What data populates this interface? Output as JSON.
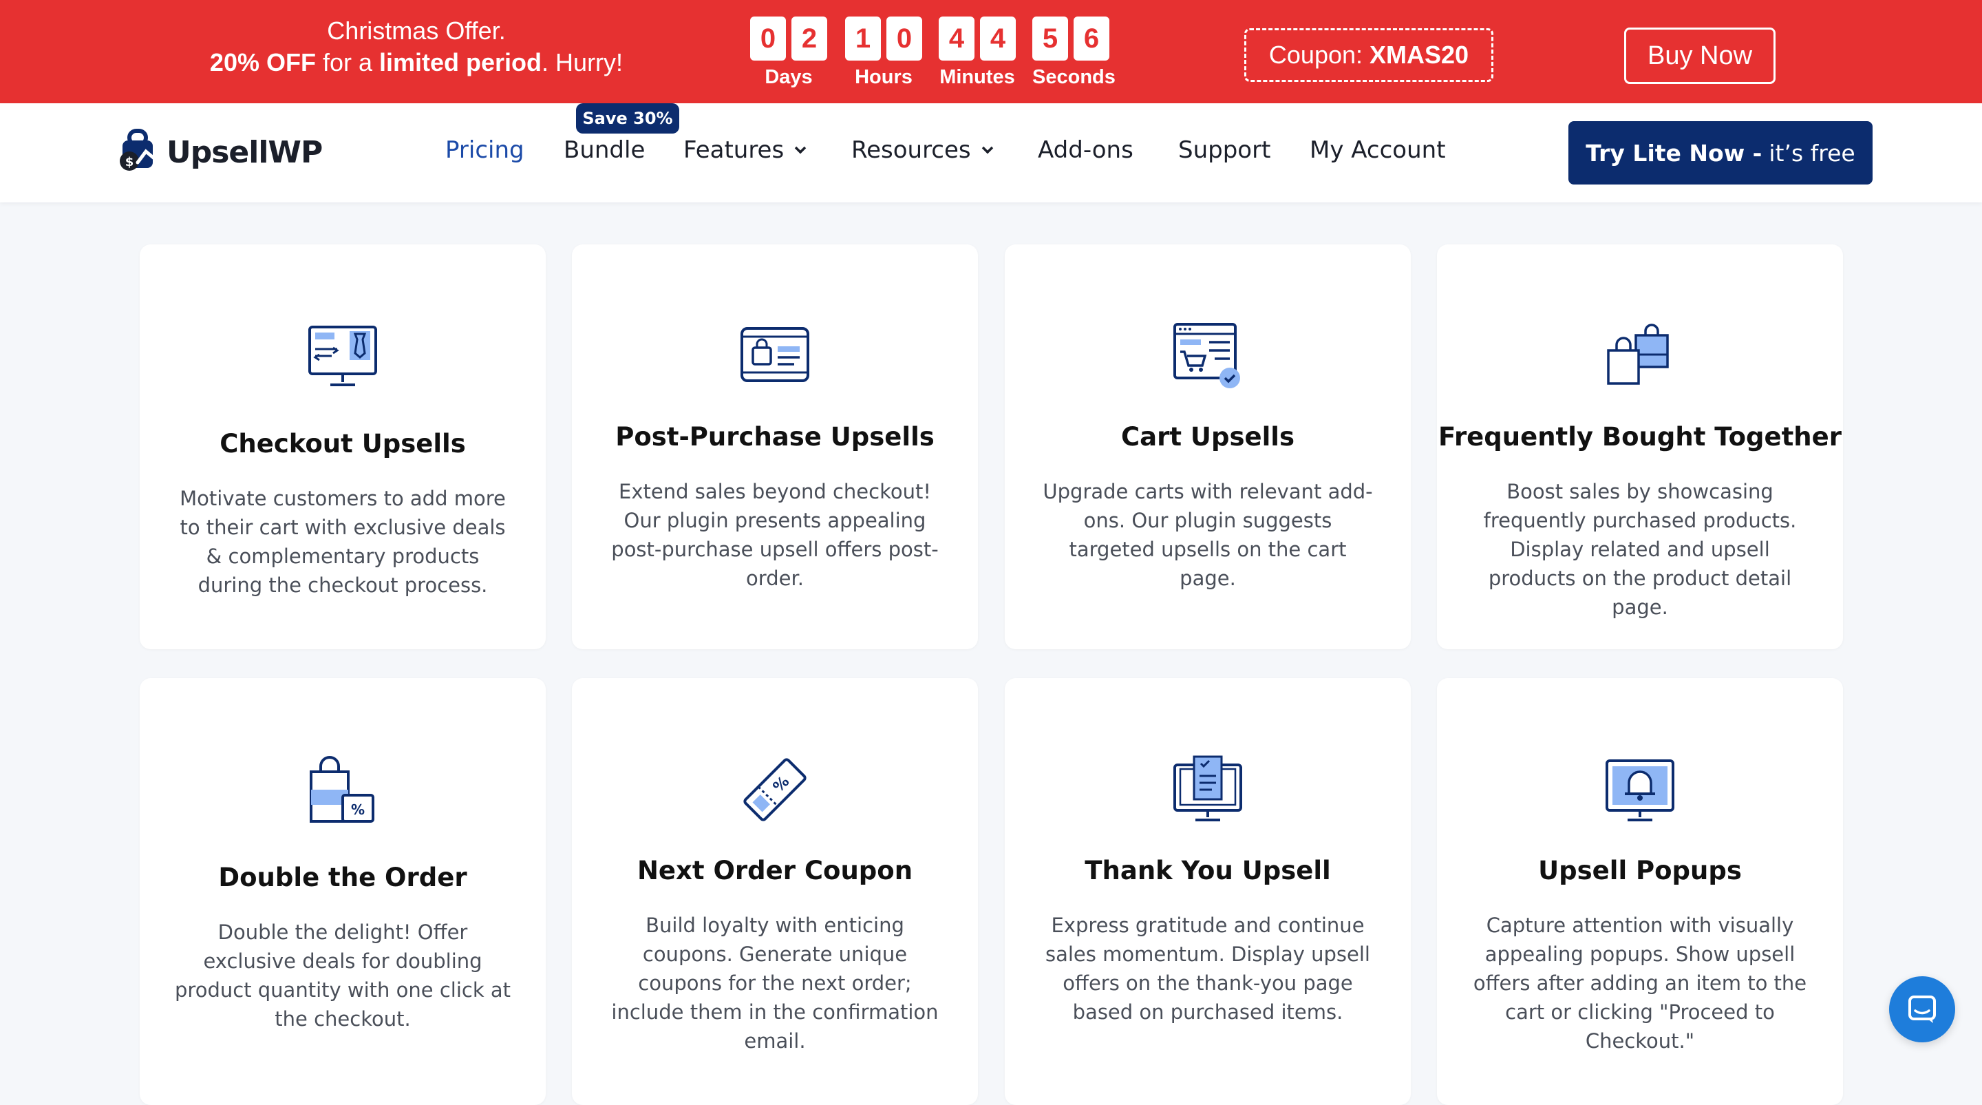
{
  "promo": {
    "line1": "Christmas Offer.",
    "line2_bold1": "20% OFF",
    "line2_mid": " for a ",
    "line2_bold2": "limited period",
    "line2_end": ". Hurry!",
    "countdown": [
      {
        "digits": [
          "0",
          "2"
        ],
        "label": "Days"
      },
      {
        "digits": [
          "1",
          "0"
        ],
        "label": "Hours"
      },
      {
        "digits": [
          "4",
          "4"
        ],
        "label": "Minutes"
      },
      {
        "digits": [
          "5",
          "6"
        ],
        "label": "Seconds"
      }
    ],
    "coupon_label": "Coupon:",
    "coupon_code": "XMAS20",
    "buy_label": "Buy Now",
    "color": "#e63131"
  },
  "header": {
    "logo_text": "UpsellWP",
    "badge": "Save 30%",
    "nav": {
      "pricing": "Pricing",
      "bundle": "Bundle",
      "features": "Features",
      "resources": "Resources",
      "addons": "Add-ons",
      "support": "Support",
      "account": "My Account"
    },
    "cta_bold": "Try Lite Now -",
    "cta_rest": "it’s free",
    "accent": "#0c2c6e"
  },
  "cards": [
    {
      "icon": "checkout-monitor-icon",
      "title": "Checkout Upsells",
      "desc": "Motivate customers to add more to their cart with exclusive deals & complementary products during the checkout process."
    },
    {
      "icon": "laptop-bag-icon",
      "title": "Post-Purchase Upsells",
      "desc": "Extend sales beyond checkout! Our plugin presents appealing post-purchase upsell offers post-order."
    },
    {
      "icon": "cart-browser-icon",
      "title": "Cart Upsells",
      "desc": "Upgrade carts with relevant add-ons. Our plugin suggests targeted upsells on the cart page."
    },
    {
      "icon": "shopping-bags-icon",
      "title": "Frequently Bought Together",
      "desc": "Boost sales by showcasing frequently purchased products. Display related and upsell products on the product detail page."
    },
    {
      "icon": "bag-discount-icon",
      "title": "Double the Order",
      "desc": "Double the delight! Offer exclusive deals for doubling product quantity with one click at the checkout."
    },
    {
      "icon": "coupon-ticket-icon",
      "title": "Next Order Coupon",
      "desc": "Build loyalty with enticing coupons. Generate unique coupons for the next order; include them in the confirmation email."
    },
    {
      "icon": "monitor-checklist-icon",
      "title": "Thank You Upsell",
      "desc": "Express gratitude and continue sales momentum. Display upsell offers on the thank-you page based on purchased items."
    },
    {
      "icon": "monitor-bell-icon",
      "title": "Upsell Popups",
      "desc": "Capture attention with visually appealing popups. Show upsell offers after adding an item to the cart or clicking \"Proceed to Checkout.\""
    }
  ],
  "chat": {
    "icon": "chat-icon"
  }
}
